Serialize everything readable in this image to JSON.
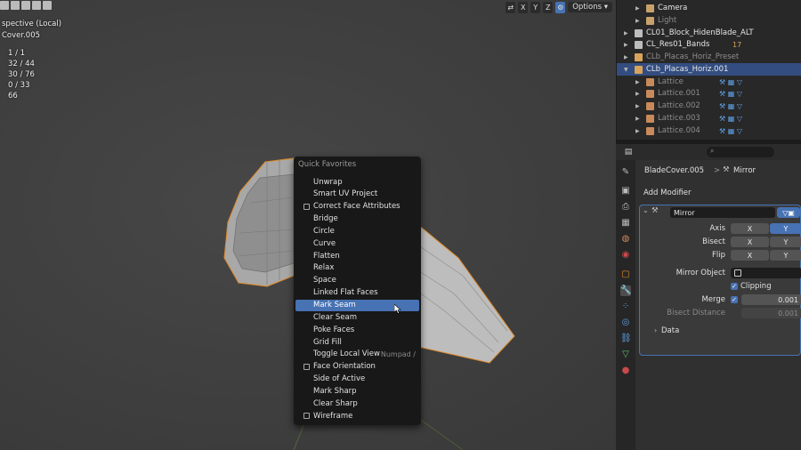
{
  "viewport": {
    "header_left_icons": [
      "select-box-icon",
      "select-extend-icon",
      "select-subtract-icon",
      "select-intersect-icon"
    ],
    "overlay_lines": [
      "spective (Local)",
      "Cover.005"
    ],
    "stats": [
      "1 / 1",
      "32 / 44",
      "30 / 76",
      "0 / 33",
      "66"
    ],
    "axes": [
      "X",
      "Y",
      "Z"
    ],
    "options_label": "Options"
  },
  "quick_favorites": {
    "title": "Quick Favorites",
    "items": [
      {
        "label": "Unwrap",
        "checkbox": false,
        "shortcut": ""
      },
      {
        "label": "Smart UV Project",
        "checkbox": false,
        "shortcut": ""
      },
      {
        "label": "Correct Face Attributes",
        "checkbox": true,
        "shortcut": ""
      },
      {
        "label": "Bridge",
        "checkbox": false,
        "shortcut": ""
      },
      {
        "label": "Circle",
        "checkbox": false,
        "shortcut": ""
      },
      {
        "label": "Curve",
        "checkbox": false,
        "shortcut": ""
      },
      {
        "label": "Flatten",
        "checkbox": false,
        "shortcut": ""
      },
      {
        "label": "Relax",
        "checkbox": false,
        "shortcut": ""
      },
      {
        "label": "Space",
        "checkbox": false,
        "shortcut": ""
      },
      {
        "label": "Linked Flat Faces",
        "checkbox": false,
        "shortcut": ""
      },
      {
        "label": "Mark Seam",
        "checkbox": false,
        "shortcut": "",
        "active": true
      },
      {
        "label": "Clear Seam",
        "checkbox": false,
        "shortcut": ""
      },
      {
        "label": "Poke Faces",
        "checkbox": false,
        "shortcut": ""
      },
      {
        "label": "Grid Fill",
        "checkbox": false,
        "shortcut": ""
      },
      {
        "label": "Toggle Local View",
        "checkbox": false,
        "shortcut": "Numpad /"
      },
      {
        "label": "Face Orientation",
        "checkbox": true,
        "shortcut": ""
      },
      {
        "label": "Side of Active",
        "checkbox": false,
        "shortcut": ""
      },
      {
        "label": "Mark Sharp",
        "checkbox": false,
        "shortcut": ""
      },
      {
        "label": "Clear Sharp",
        "checkbox": false,
        "shortcut": ""
      },
      {
        "label": "Wireframe",
        "checkbox": true,
        "shortcut": ""
      }
    ]
  },
  "outliner": {
    "rows": [
      {
        "label": "Camera",
        "depth": 2,
        "icon_color": "#c9a26b",
        "dim": false,
        "sel": false
      },
      {
        "label": "Light",
        "depth": 2,
        "icon_color": "#c9a26b",
        "dim": true,
        "sel": false
      },
      {
        "label": "CL01_Block_HidenBlade_ALT",
        "depth": 1,
        "icon_color": "#bdbdbd",
        "dim": false,
        "sel": false
      },
      {
        "label": "CL_Res01_Bands",
        "depth": 1,
        "icon_color": "#bdbdbd",
        "dim": false,
        "sel": false,
        "extra": "17"
      },
      {
        "label": "CLb_Placas_Horiz_Preset",
        "depth": 1,
        "icon_color": "#d7a35b",
        "dim": true,
        "sel": false
      },
      {
        "label": "CLb_Placas_Horiz.001",
        "depth": 1,
        "icon_color": "#d7a35b",
        "dim": false,
        "sel": true
      },
      {
        "label": "Lattice",
        "depth": 2,
        "icon_color": "#c98a5b",
        "dim": true,
        "sel": false
      },
      {
        "label": "Lattice.001",
        "depth": 2,
        "icon_color": "#c98a5b",
        "dim": true,
        "sel": false
      },
      {
        "label": "Lattice.002",
        "depth": 2,
        "icon_color": "#c98a5b",
        "dim": true,
        "sel": false
      },
      {
        "label": "Lattice.003",
        "depth": 2,
        "icon_color": "#c98a5b",
        "dim": true,
        "sel": false
      },
      {
        "label": "Lattice.004",
        "depth": 2,
        "icon_color": "#c98a5b",
        "dim": true,
        "sel": false
      }
    ]
  },
  "properties": {
    "breadcrumb_object": "BladeCover.005",
    "breadcrumb_sep": ">",
    "breadcrumb_modifier": "Mirror",
    "add_modifier": "Add Modifier",
    "modifier_name": "Mirror",
    "axis_label": "Axis",
    "bisect_label": "Bisect",
    "flip_label": "Flip",
    "x": "X",
    "y": "Y",
    "mirror_object_label": "Mirror Object",
    "clipping_label": "Clipping",
    "merge_label": "Merge",
    "merge_value": "0.001",
    "bisect_distance_label": "Bisect Distance",
    "bisect_distance_value": "0.001",
    "data_label": "Data",
    "accent_color": "#4772b3"
  }
}
